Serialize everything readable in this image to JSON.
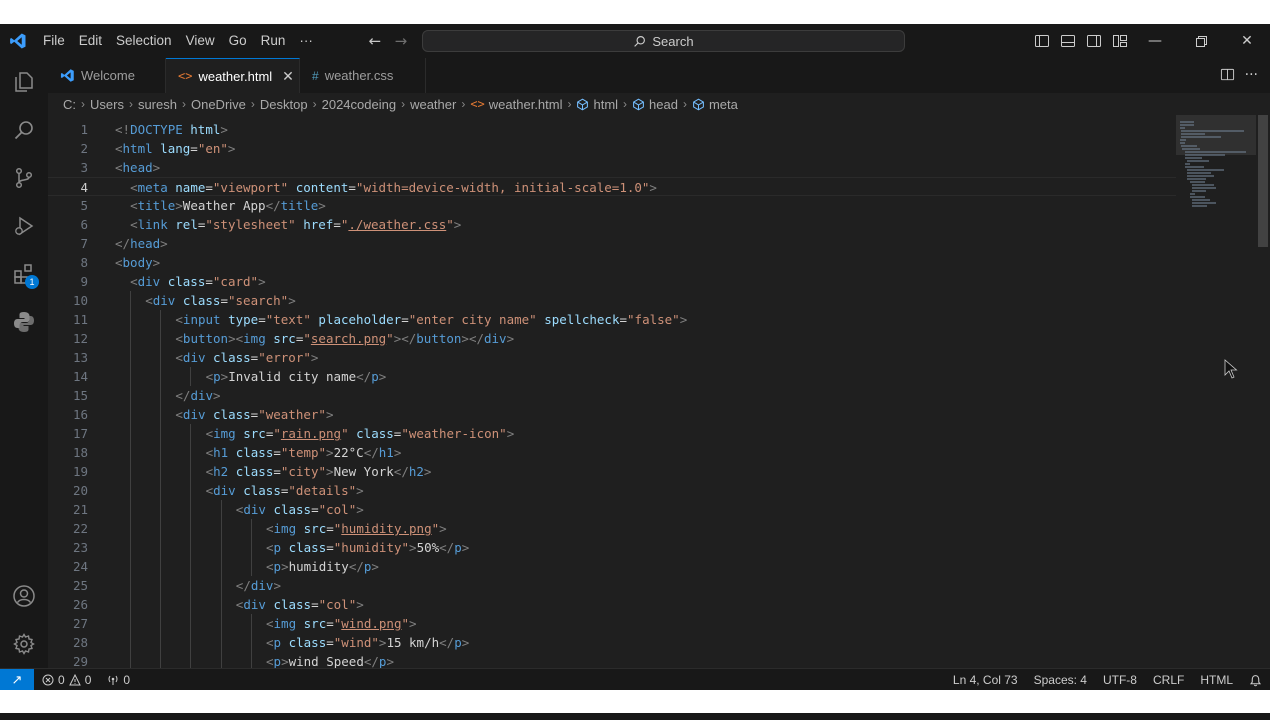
{
  "menu": [
    "File",
    "Edit",
    "Selection",
    "View",
    "Go",
    "Run",
    "···"
  ],
  "search": {
    "label": "Search"
  },
  "tabs": [
    {
      "label": "Welcome",
      "icon": "vscode-icon"
    },
    {
      "label": "weather.html",
      "icon": "html-file-icon",
      "close": "✕"
    },
    {
      "label": "weather.css",
      "icon": "css-file-icon"
    }
  ],
  "breadcrumb": {
    "drive": "C:",
    "folders": [
      "Users",
      "suresh",
      "OneDrive",
      "Desktop",
      "2024codeing",
      "weather"
    ],
    "file": "weather.html",
    "symbols": [
      "html",
      "head",
      "meta"
    ]
  },
  "activity": {
    "extensions_badge": "1"
  },
  "status": {
    "errors": "0",
    "warnings": "0",
    "ports": "0",
    "position": "Ln 4, Col 73",
    "spaces": "Spaces: 4",
    "encoding": "UTF-8",
    "eol": "CRLF",
    "language": "HTML"
  },
  "colors": {
    "accent": "#0078d4",
    "background": "#1f1f1f",
    "chrome": "#181818"
  },
  "code": {
    "current_line": 4,
    "lines": [
      {
        "n": "1",
        "indent": 0,
        "tokens": [
          [
            "b",
            "<!"
          ],
          [
            "t",
            "DOCTYPE"
          ],
          [
            "x",
            " "
          ],
          [
            "a",
            "html"
          ],
          [
            "b",
            ">"
          ]
        ]
      },
      {
        "n": "2",
        "indent": 0,
        "tokens": [
          [
            "b",
            "<"
          ],
          [
            "t",
            "html"
          ],
          [
            "x",
            " "
          ],
          [
            "a",
            "lang"
          ],
          [
            "x",
            "="
          ],
          [
            "s",
            "\"en\""
          ],
          [
            "b",
            ">"
          ]
        ]
      },
      {
        "n": "3",
        "indent": 0,
        "tokens": [
          [
            "b",
            "<"
          ],
          [
            "t",
            "head"
          ],
          [
            "b",
            ">"
          ]
        ]
      },
      {
        "n": "4",
        "indent": 1,
        "tokens": [
          [
            "b",
            "<"
          ],
          [
            "t",
            "meta"
          ],
          [
            "x",
            " "
          ],
          [
            "a",
            "name"
          ],
          [
            "x",
            "="
          ],
          [
            "s",
            "\"viewport\""
          ],
          [
            "x",
            " "
          ],
          [
            "a",
            "content"
          ],
          [
            "x",
            "="
          ],
          [
            "s",
            "\"width=device-width, initial-scale=1.0\""
          ],
          [
            "b",
            ">"
          ]
        ]
      },
      {
        "n": "5",
        "indent": 1,
        "tokens": [
          [
            "b",
            "<"
          ],
          [
            "t",
            "title"
          ],
          [
            "b",
            ">"
          ],
          [
            "x",
            "Weather App"
          ],
          [
            "b",
            "</"
          ],
          [
            "t",
            "title"
          ],
          [
            "b",
            ">"
          ]
        ]
      },
      {
        "n": "6",
        "indent": 1,
        "tokens": [
          [
            "b",
            "<"
          ],
          [
            "t",
            "link"
          ],
          [
            "x",
            " "
          ],
          [
            "a",
            "rel"
          ],
          [
            "x",
            "="
          ],
          [
            "s",
            "\"stylesheet\""
          ],
          [
            "x",
            " "
          ],
          [
            "a",
            "href"
          ],
          [
            "x",
            "="
          ],
          [
            "s",
            "\""
          ],
          [
            "link",
            "./weather.css"
          ],
          [
            "s",
            "\""
          ],
          [
            "b",
            ">"
          ]
        ]
      },
      {
        "n": "7",
        "indent": 0,
        "tokens": [
          [
            "b",
            "</"
          ],
          [
            "t",
            "head"
          ],
          [
            "b",
            ">"
          ]
        ]
      },
      {
        "n": "8",
        "indent": 0,
        "tokens": [
          [
            "b",
            "<"
          ],
          [
            "t",
            "body"
          ],
          [
            "b",
            ">"
          ]
        ]
      },
      {
        "n": "9",
        "indent": 1,
        "tokens": [
          [
            "b",
            "<"
          ],
          [
            "t",
            "div"
          ],
          [
            "x",
            " "
          ],
          [
            "a",
            "class"
          ],
          [
            "x",
            "="
          ],
          [
            "s",
            "\"card\""
          ],
          [
            "b",
            ">"
          ]
        ]
      },
      {
        "n": "10",
        "indent": 2,
        "tokens": [
          [
            "b",
            "<"
          ],
          [
            "t",
            "div"
          ],
          [
            "x",
            " "
          ],
          [
            "a",
            "class"
          ],
          [
            "x",
            "="
          ],
          [
            "s",
            "\"search\""
          ],
          [
            "b",
            ">"
          ]
        ]
      },
      {
        "n": "11",
        "indent": 4,
        "tokens": [
          [
            "b",
            "<"
          ],
          [
            "t",
            "input"
          ],
          [
            "x",
            " "
          ],
          [
            "a",
            "type"
          ],
          [
            "x",
            "="
          ],
          [
            "s",
            "\"text\""
          ],
          [
            "x",
            " "
          ],
          [
            "a",
            "placeholder"
          ],
          [
            "x",
            "="
          ],
          [
            "s",
            "\"enter city name\""
          ],
          [
            "x",
            " "
          ],
          [
            "a",
            "spellcheck"
          ],
          [
            "x",
            "="
          ],
          [
            "s",
            "\"false\""
          ],
          [
            "b",
            ">"
          ]
        ]
      },
      {
        "n": "12",
        "indent": 4,
        "tokens": [
          [
            "b",
            "<"
          ],
          [
            "t",
            "button"
          ],
          [
            "b",
            "><"
          ],
          [
            "t",
            "img"
          ],
          [
            "x",
            " "
          ],
          [
            "a",
            "src"
          ],
          [
            "x",
            "="
          ],
          [
            "s",
            "\""
          ],
          [
            "link",
            "search.png"
          ],
          [
            "s",
            "\""
          ],
          [
            "b",
            "></"
          ],
          [
            "t",
            "button"
          ],
          [
            "b",
            "></"
          ],
          [
            "t",
            "div"
          ],
          [
            "b",
            ">"
          ]
        ]
      },
      {
        "n": "13",
        "indent": 4,
        "tokens": [
          [
            "b",
            "<"
          ],
          [
            "t",
            "div"
          ],
          [
            "x",
            " "
          ],
          [
            "a",
            "class"
          ],
          [
            "x",
            "="
          ],
          [
            "s",
            "\"error\""
          ],
          [
            "b",
            ">"
          ]
        ]
      },
      {
        "n": "14",
        "indent": 6,
        "tokens": [
          [
            "b",
            "<"
          ],
          [
            "t",
            "p"
          ],
          [
            "b",
            ">"
          ],
          [
            "x",
            "Invalid city name"
          ],
          [
            "b",
            "</"
          ],
          [
            "t",
            "p"
          ],
          [
            "b",
            ">"
          ]
        ]
      },
      {
        "n": "15",
        "indent": 4,
        "tokens": [
          [
            "b",
            "</"
          ],
          [
            "t",
            "div"
          ],
          [
            "b",
            ">"
          ]
        ]
      },
      {
        "n": "16",
        "indent": 4,
        "tokens": [
          [
            "b",
            "<"
          ],
          [
            "t",
            "div"
          ],
          [
            "x",
            " "
          ],
          [
            "a",
            "class"
          ],
          [
            "x",
            "="
          ],
          [
            "s",
            "\"weather\""
          ],
          [
            "b",
            ">"
          ]
        ]
      },
      {
        "n": "17",
        "indent": 6,
        "tokens": [
          [
            "b",
            "<"
          ],
          [
            "t",
            "img"
          ],
          [
            "x",
            " "
          ],
          [
            "a",
            "src"
          ],
          [
            "x",
            "="
          ],
          [
            "s",
            "\""
          ],
          [
            "link",
            "rain.png"
          ],
          [
            "s",
            "\""
          ],
          [
            "x",
            " "
          ],
          [
            "a",
            "class"
          ],
          [
            "x",
            "="
          ],
          [
            "s",
            "\"weather-icon\""
          ],
          [
            "b",
            ">"
          ]
        ]
      },
      {
        "n": "18",
        "indent": 6,
        "tokens": [
          [
            "b",
            "<"
          ],
          [
            "t",
            "h1"
          ],
          [
            "x",
            " "
          ],
          [
            "a",
            "class"
          ],
          [
            "x",
            "="
          ],
          [
            "s",
            "\"temp\""
          ],
          [
            "b",
            ">"
          ],
          [
            "x",
            "22°C"
          ],
          [
            "b",
            "</"
          ],
          [
            "t",
            "h1"
          ],
          [
            "b",
            ">"
          ]
        ]
      },
      {
        "n": "19",
        "indent": 6,
        "tokens": [
          [
            "b",
            "<"
          ],
          [
            "t",
            "h2"
          ],
          [
            "x",
            " "
          ],
          [
            "a",
            "class"
          ],
          [
            "x",
            "="
          ],
          [
            "s",
            "\"city\""
          ],
          [
            "b",
            ">"
          ],
          [
            "x",
            "New York"
          ],
          [
            "b",
            "</"
          ],
          [
            "t",
            "h2"
          ],
          [
            "b",
            ">"
          ]
        ]
      },
      {
        "n": "20",
        "indent": 6,
        "tokens": [
          [
            "b",
            "<"
          ],
          [
            "t",
            "div"
          ],
          [
            "x",
            " "
          ],
          [
            "a",
            "class"
          ],
          [
            "x",
            "="
          ],
          [
            "s",
            "\"details\""
          ],
          [
            "b",
            ">"
          ]
        ]
      },
      {
        "n": "21",
        "indent": 8,
        "tokens": [
          [
            "b",
            "<"
          ],
          [
            "t",
            "div"
          ],
          [
            "x",
            " "
          ],
          [
            "a",
            "class"
          ],
          [
            "x",
            "="
          ],
          [
            "s",
            "\"col\""
          ],
          [
            "b",
            ">"
          ]
        ]
      },
      {
        "n": "22",
        "indent": 10,
        "tokens": [
          [
            "b",
            "<"
          ],
          [
            "t",
            "img"
          ],
          [
            "x",
            " "
          ],
          [
            "a",
            "src"
          ],
          [
            "x",
            "="
          ],
          [
            "s",
            "\""
          ],
          [
            "link",
            "humidity.png"
          ],
          [
            "s",
            "\""
          ],
          [
            "b",
            ">"
          ]
        ]
      },
      {
        "n": "23",
        "indent": 10,
        "tokens": [
          [
            "b",
            "<"
          ],
          [
            "t",
            "p"
          ],
          [
            "x",
            " "
          ],
          [
            "a",
            "class"
          ],
          [
            "x",
            "="
          ],
          [
            "s",
            "\"humidity\""
          ],
          [
            "b",
            ">"
          ],
          [
            "x",
            "50%"
          ],
          [
            "b",
            "</"
          ],
          [
            "t",
            "p"
          ],
          [
            "b",
            ">"
          ]
        ]
      },
      {
        "n": "24",
        "indent": 10,
        "tokens": [
          [
            "b",
            "<"
          ],
          [
            "t",
            "p"
          ],
          [
            "b",
            ">"
          ],
          [
            "x",
            "humidity"
          ],
          [
            "b",
            "</"
          ],
          [
            "t",
            "p"
          ],
          [
            "b",
            ">"
          ]
        ]
      },
      {
        "n": "25",
        "indent": 8,
        "tokens": [
          [
            "b",
            "</"
          ],
          [
            "t",
            "div"
          ],
          [
            "b",
            ">"
          ]
        ]
      },
      {
        "n": "26",
        "indent": 8,
        "tokens": [
          [
            "b",
            "<"
          ],
          [
            "t",
            "div"
          ],
          [
            "x",
            " "
          ],
          [
            "a",
            "class"
          ],
          [
            "x",
            "="
          ],
          [
            "s",
            "\"col\""
          ],
          [
            "b",
            ">"
          ]
        ]
      },
      {
        "n": "27",
        "indent": 10,
        "tokens": [
          [
            "b",
            "<"
          ],
          [
            "t",
            "img"
          ],
          [
            "x",
            " "
          ],
          [
            "a",
            "src"
          ],
          [
            "x",
            "="
          ],
          [
            "s",
            "\""
          ],
          [
            "link",
            "wind.png"
          ],
          [
            "s",
            "\""
          ],
          [
            "b",
            ">"
          ]
        ]
      },
      {
        "n": "28",
        "indent": 10,
        "tokens": [
          [
            "b",
            "<"
          ],
          [
            "t",
            "p"
          ],
          [
            "x",
            " "
          ],
          [
            "a",
            "class"
          ],
          [
            "x",
            "="
          ],
          [
            "s",
            "\"wind\""
          ],
          [
            "b",
            ">"
          ],
          [
            "x",
            "15 km/h"
          ],
          [
            "b",
            "</"
          ],
          [
            "t",
            "p"
          ],
          [
            "b",
            ">"
          ]
        ]
      },
      {
        "n": "29",
        "indent": 10,
        "tokens": [
          [
            "b",
            "<"
          ],
          [
            "t",
            "p"
          ],
          [
            "b",
            ">"
          ],
          [
            "x",
            "wind Speed"
          ],
          [
            "b",
            "</"
          ],
          [
            "t",
            "p"
          ],
          [
            "b",
            ">"
          ]
        ]
      }
    ]
  }
}
